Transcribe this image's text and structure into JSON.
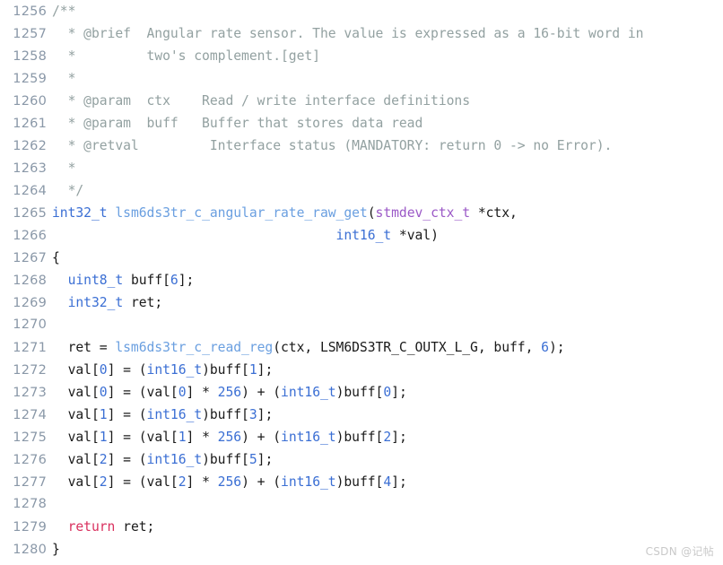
{
  "editor": {
    "language": "c",
    "background_color": "#ffffff",
    "gutter_color": "#8a98a8",
    "first_line_number": 1256,
    "last_line_number": 1280,
    "colors": {
      "comment": "#93a1a1",
      "type_keyword": "#3b6fd4",
      "struct_type": "#9b59c7",
      "function_name": "#6a9fe0",
      "number": "#3b6fd4",
      "control_keyword": "#d9305e",
      "plain_text": "#1a1a1a"
    }
  },
  "lines": [
    {
      "number": "1256",
      "tokens": [
        {
          "t": "/**",
          "c": "comment"
        }
      ]
    },
    {
      "number": "1257",
      "tokens": [
        {
          "t": "  * @brief  Angular rate sensor. The value is expressed as a 16-bit word in",
          "c": "comment"
        }
      ]
    },
    {
      "number": "1258",
      "tokens": [
        {
          "t": "  *         two's complement.[get]",
          "c": "comment"
        }
      ]
    },
    {
      "number": "1259",
      "tokens": [
        {
          "t": "  *",
          "c": "comment"
        }
      ]
    },
    {
      "number": "1260",
      "tokens": [
        {
          "t": "  * @param  ctx    Read / write interface definitions",
          "c": "comment"
        }
      ]
    },
    {
      "number": "1261",
      "tokens": [
        {
          "t": "  * @param  buff   Buffer that stores data read",
          "c": "comment"
        }
      ]
    },
    {
      "number": "1262",
      "tokens": [
        {
          "t": "  * @retval         Interface status (MANDATORY: return 0 -> no Error).",
          "c": "comment"
        }
      ]
    },
    {
      "number": "1263",
      "tokens": [
        {
          "t": "  *",
          "c": "comment"
        }
      ]
    },
    {
      "number": "1264",
      "tokens": [
        {
          "t": "  */",
          "c": "comment"
        }
      ]
    },
    {
      "number": "1265",
      "tokens": [
        {
          "t": "int32_t",
          "c": "type"
        },
        {
          "t": " ",
          "c": "plain"
        },
        {
          "t": "lsm6ds3tr_c_angular_rate_raw_get",
          "c": "fn"
        },
        {
          "t": "(",
          "c": "plain"
        },
        {
          "t": "stmdev_ctx_t",
          "c": "struct"
        },
        {
          "t": " *ctx,",
          "c": "plain"
        }
      ]
    },
    {
      "number": "1266",
      "tokens": [
        {
          "t": "                                    ",
          "c": "plain"
        },
        {
          "t": "int16_t",
          "c": "type"
        },
        {
          "t": " *val)",
          "c": "plain"
        }
      ]
    },
    {
      "number": "1267",
      "tokens": [
        {
          "t": "{",
          "c": "brace"
        }
      ]
    },
    {
      "number": "1268",
      "tokens": [
        {
          "t": "  ",
          "c": "plain"
        },
        {
          "t": "uint8_t",
          "c": "type"
        },
        {
          "t": " buff[",
          "c": "plain"
        },
        {
          "t": "6",
          "c": "num"
        },
        {
          "t": "];",
          "c": "plain"
        }
      ]
    },
    {
      "number": "1269",
      "tokens": [
        {
          "t": "  ",
          "c": "plain"
        },
        {
          "t": "int32_t",
          "c": "type"
        },
        {
          "t": " ret;",
          "c": "plain"
        }
      ]
    },
    {
      "number": "1270",
      "tokens": [
        {
          "t": "",
          "c": "plain"
        }
      ]
    },
    {
      "number": "1271",
      "tokens": [
        {
          "t": "  ret = ",
          "c": "plain"
        },
        {
          "t": "lsm6ds3tr_c_read_reg",
          "c": "fn"
        },
        {
          "t": "(ctx, ",
          "c": "plain"
        },
        {
          "t": "LSM6DS3TR_C_OUTX_L_G",
          "c": "const"
        },
        {
          "t": ", buff, ",
          "c": "plain"
        },
        {
          "t": "6",
          "c": "num"
        },
        {
          "t": ");",
          "c": "plain"
        }
      ]
    },
    {
      "number": "1272",
      "tokens": [
        {
          "t": "  val[",
          "c": "plain"
        },
        {
          "t": "0",
          "c": "num"
        },
        {
          "t": "] = (",
          "c": "plain"
        },
        {
          "t": "int16_t",
          "c": "type"
        },
        {
          "t": ")buff[",
          "c": "plain"
        },
        {
          "t": "1",
          "c": "num"
        },
        {
          "t": "];",
          "c": "plain"
        }
      ]
    },
    {
      "number": "1273",
      "tokens": [
        {
          "t": "  val[",
          "c": "plain"
        },
        {
          "t": "0",
          "c": "num"
        },
        {
          "t": "] = (val[",
          "c": "plain"
        },
        {
          "t": "0",
          "c": "num"
        },
        {
          "t": "] * ",
          "c": "plain"
        },
        {
          "t": "256",
          "c": "num"
        },
        {
          "t": ") + (",
          "c": "plain"
        },
        {
          "t": "int16_t",
          "c": "type"
        },
        {
          "t": ")buff[",
          "c": "plain"
        },
        {
          "t": "0",
          "c": "num"
        },
        {
          "t": "];",
          "c": "plain"
        }
      ]
    },
    {
      "number": "1274",
      "tokens": [
        {
          "t": "  val[",
          "c": "plain"
        },
        {
          "t": "1",
          "c": "num"
        },
        {
          "t": "] = (",
          "c": "plain"
        },
        {
          "t": "int16_t",
          "c": "type"
        },
        {
          "t": ")buff[",
          "c": "plain"
        },
        {
          "t": "3",
          "c": "num"
        },
        {
          "t": "];",
          "c": "plain"
        }
      ]
    },
    {
      "number": "1275",
      "tokens": [
        {
          "t": "  val[",
          "c": "plain"
        },
        {
          "t": "1",
          "c": "num"
        },
        {
          "t": "] = (val[",
          "c": "plain"
        },
        {
          "t": "1",
          "c": "num"
        },
        {
          "t": "] * ",
          "c": "plain"
        },
        {
          "t": "256",
          "c": "num"
        },
        {
          "t": ") + (",
          "c": "plain"
        },
        {
          "t": "int16_t",
          "c": "type"
        },
        {
          "t": ")buff[",
          "c": "plain"
        },
        {
          "t": "2",
          "c": "num"
        },
        {
          "t": "];",
          "c": "plain"
        }
      ]
    },
    {
      "number": "1276",
      "tokens": [
        {
          "t": "  val[",
          "c": "plain"
        },
        {
          "t": "2",
          "c": "num"
        },
        {
          "t": "] = (",
          "c": "plain"
        },
        {
          "t": "int16_t",
          "c": "type"
        },
        {
          "t": ")buff[",
          "c": "plain"
        },
        {
          "t": "5",
          "c": "num"
        },
        {
          "t": "];",
          "c": "plain"
        }
      ]
    },
    {
      "number": "1277",
      "tokens": [
        {
          "t": "  val[",
          "c": "plain"
        },
        {
          "t": "2",
          "c": "num"
        },
        {
          "t": "] = (val[",
          "c": "plain"
        },
        {
          "t": "2",
          "c": "num"
        },
        {
          "t": "] * ",
          "c": "plain"
        },
        {
          "t": "256",
          "c": "num"
        },
        {
          "t": ") + (",
          "c": "plain"
        },
        {
          "t": "int16_t",
          "c": "type"
        },
        {
          "t": ")buff[",
          "c": "plain"
        },
        {
          "t": "4",
          "c": "num"
        },
        {
          "t": "];",
          "c": "plain"
        }
      ]
    },
    {
      "number": "1278",
      "tokens": [
        {
          "t": "",
          "c": "plain"
        }
      ]
    },
    {
      "number": "1279",
      "tokens": [
        {
          "t": "  ",
          "c": "plain"
        },
        {
          "t": "return",
          "c": "kw"
        },
        {
          "t": " ret;",
          "c": "plain"
        }
      ]
    },
    {
      "number": "1280",
      "tokens": [
        {
          "t": "}",
          "c": "brace"
        }
      ]
    }
  ],
  "watermark": {
    "text": "CSDN @记帖"
  }
}
